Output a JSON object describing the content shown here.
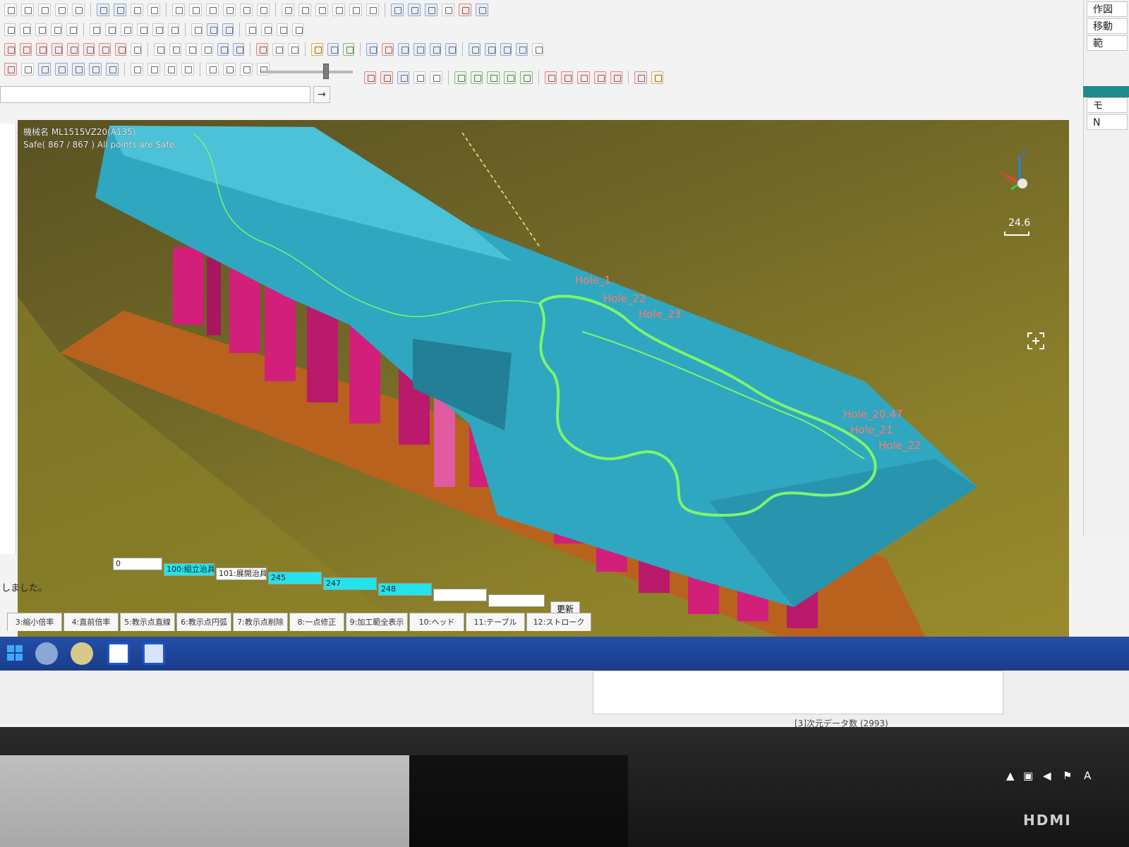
{
  "viewport": {
    "title": "機械名 ML1515VZ20(A135)",
    "status": "Safe( 867 / 867 ) All points are Safe.",
    "scale": "24.6",
    "axis": {
      "x": "X",
      "z": "Z"
    },
    "labels": [
      "Hole_1",
      "Hole_22",
      "Hole_23",
      "Hole_20.47",
      "Hole_21",
      "Hole_22"
    ]
  },
  "toolbar": {
    "cmd_go": "→"
  },
  "right_panel": {
    "items": [
      "作図",
      "移動",
      "範",
      "モ",
      "N"
    ]
  },
  "fields": {
    "f0": "0",
    "f1": "100:組立治具",
    "f2": "101:展開治具",
    "f3": "245",
    "f4": "247",
    "f5": "248",
    "update": "更新"
  },
  "message": "しました。",
  "fkeys": [
    "3:縮小倍率",
    "4:直前倍率",
    "5:教示点直線",
    "6:教示点円弧",
    "7:教示点削除",
    "8:一点修正",
    "9:加工範全表示",
    "10:ヘッド",
    "11:テーブル",
    "12:ストローク"
  ],
  "bottom": {
    "data_count": "[3]次元データ数 (2993)"
  },
  "tray": {
    "ime": "A"
  },
  "monitor": {
    "brand": "HDMI"
  },
  "colors": {
    "part": "#2fa7c0",
    "fixture": "#d11f7a",
    "base": "#b8621e",
    "path": "#7cf56b",
    "label": "#ff7a6a",
    "field_cyan": "#25e3ea",
    "taskbar": "#234ea8"
  }
}
